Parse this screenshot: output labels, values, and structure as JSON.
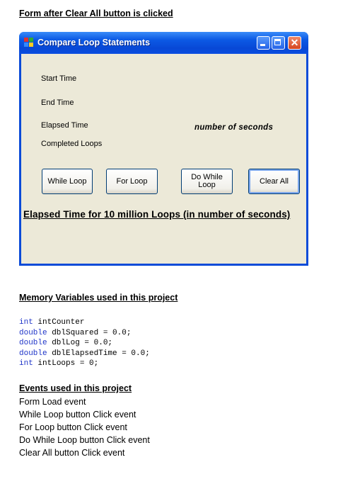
{
  "doc": {
    "heading_form": "Form after Clear All button is clicked",
    "heading_memory": "Memory Variables used in this project",
    "heading_events": "Events used in this project"
  },
  "window": {
    "title": "Compare Loop Statements",
    "labels": {
      "start_time": "Start Time",
      "end_time": "End Time",
      "elapsed_time": "Elapsed Time",
      "completed_loops": "Completed Loops"
    },
    "seconds_text": "number of seconds",
    "buttons": {
      "while_loop": "While Loop",
      "for_loop": "For Loop",
      "do_while_line1": "Do While",
      "do_while_line2": "Loop",
      "clear_all": "Clear All"
    },
    "elapsed_caption": "Elapsed Time for 10 million Loops (in number of seconds)",
    "close_glyph": "✕"
  },
  "variables": [
    {
      "type": "int",
      "rest": " intCounter"
    },
    {
      "type": "double",
      "rest": " dblSquared = 0.0;"
    },
    {
      "type": "double",
      "rest": " dblLog = 0.0;"
    },
    {
      "type": "double",
      "rest": " dblElapsedTime = 0.0;"
    },
    {
      "type": "int",
      "rest": " intLoops = 0;"
    }
  ],
  "events": [
    "Form Load event",
    "While Loop button Click event",
    "For Loop button Click event",
    "Do While Loop button Click event",
    "Clear All button Click event"
  ]
}
